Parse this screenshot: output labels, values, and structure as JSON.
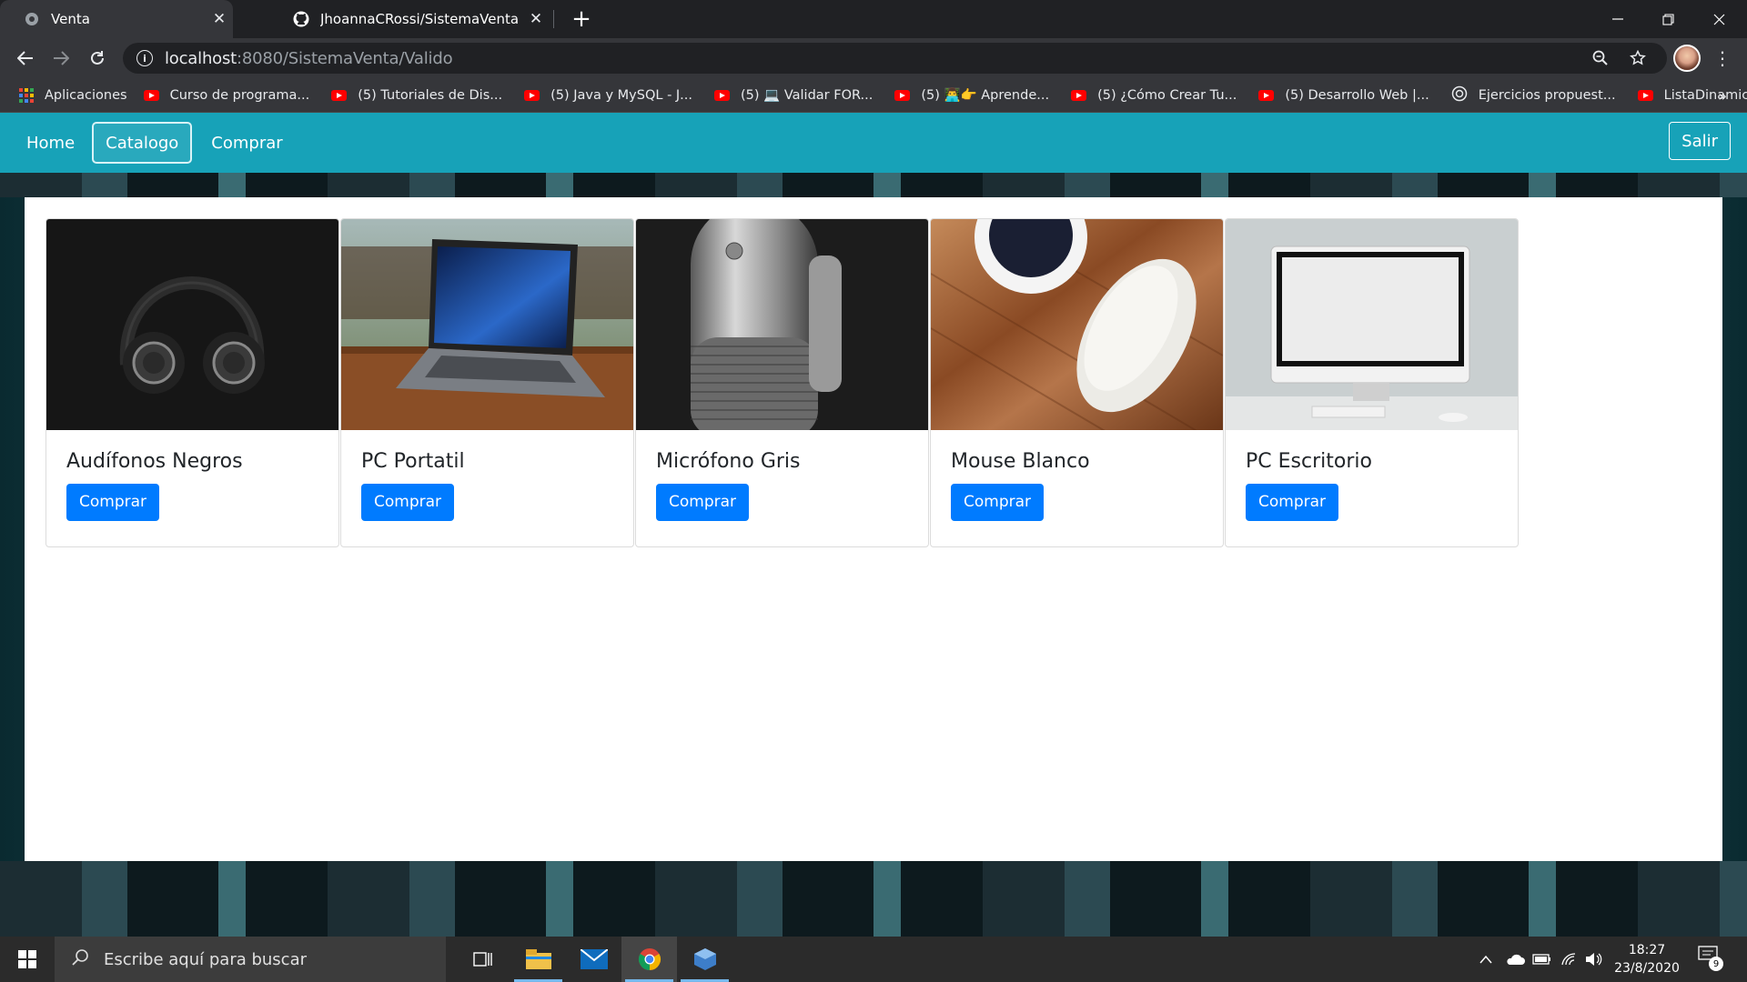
{
  "browser": {
    "tabs": [
      {
        "title": "Venta",
        "active": true,
        "icon": "globe-icon"
      },
      {
        "title": "JhoannaCRossi/SistemaVenta",
        "active": false,
        "icon": "github-icon"
      }
    ],
    "new_tab_label": "+",
    "close_label": "✕",
    "url_host": "localhost",
    "url_rest": ":8080/SistemaVenta/Valido",
    "bookmarks": [
      {
        "label": "Aplicaciones",
        "icon": "apps-icon"
      },
      {
        "label": "Curso de programa...",
        "icon": "youtube-icon"
      },
      {
        "label": "(5) Tutoriales de Dis...",
        "icon": "youtube-icon"
      },
      {
        "label": "(5) Java y MySQL - J...",
        "icon": "youtube-icon"
      },
      {
        "label": "(5) 💻 Validar FOR...",
        "icon": "youtube-icon"
      },
      {
        "label": "(5) 👨‍💻👉 Aprende...",
        "icon": "youtube-icon"
      },
      {
        "label": "(5) ¿Cómo Crear Tu...",
        "icon": "youtube-icon"
      },
      {
        "label": "(5) Desarrollo Web |...",
        "icon": "youtube-icon"
      },
      {
        "label": "Ejercicios propuest...",
        "icon": "web-icon"
      },
      {
        "label": "ListaDinamica DDR",
        "icon": "youtube-icon"
      }
    ],
    "more_bookmarks": "»"
  },
  "nav": {
    "links": [
      "Home",
      "Catalogo",
      "Comprar"
    ],
    "active": "Catalogo",
    "logout": "Salir",
    "accent": "#17a2b8"
  },
  "products": [
    {
      "name": "Audífonos Negros",
      "button": "Comprar",
      "image": "headphones"
    },
    {
      "name": "PC Portatil",
      "button": "Comprar",
      "image": "laptop"
    },
    {
      "name": "Micrófono Gris",
      "button": "Comprar",
      "image": "microphone"
    },
    {
      "name": "Mouse Blanco",
      "button": "Comprar",
      "image": "mouse"
    },
    {
      "name": "PC Escritorio",
      "button": "Comprar",
      "image": "desktop"
    }
  ],
  "button_color": "#007bff",
  "taskbar": {
    "search_placeholder": "Escribe aquí para buscar",
    "time": "18:27",
    "date": "23/8/2020",
    "notification_count": "9"
  }
}
